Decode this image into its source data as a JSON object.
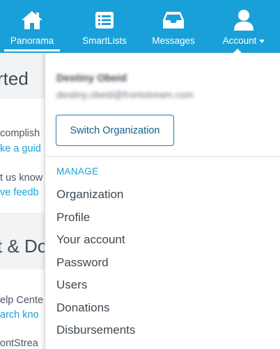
{
  "nav": {
    "items": [
      {
        "label": "Panorama",
        "icon": "home-icon",
        "active": true
      },
      {
        "label": "SmartLists",
        "icon": "list-icon"
      },
      {
        "label": "Messages",
        "icon": "inbox-icon"
      },
      {
        "label": "Account",
        "icon": "user-icon"
      }
    ],
    "bar_color": "#1aa0d8"
  },
  "background": {
    "heading1": "rted",
    "text1": "complish",
    "link1": "ke a guid",
    "text2": "t us know",
    "link2": "ve feedb",
    "heading2": "t & Do",
    "text3": "elp Cente",
    "link3": "arch kno",
    "text4": "ontStrea"
  },
  "account_menu": {
    "user_name": "Destiny Obeid",
    "user_email": "destiny.obeid@frontstream.com",
    "switch_org_label": "Switch Organization",
    "section_label": "MANAGE",
    "items": [
      "Organization",
      "Profile",
      "Your account",
      "Password",
      "Users",
      "Donations",
      "Disbursements"
    ]
  }
}
